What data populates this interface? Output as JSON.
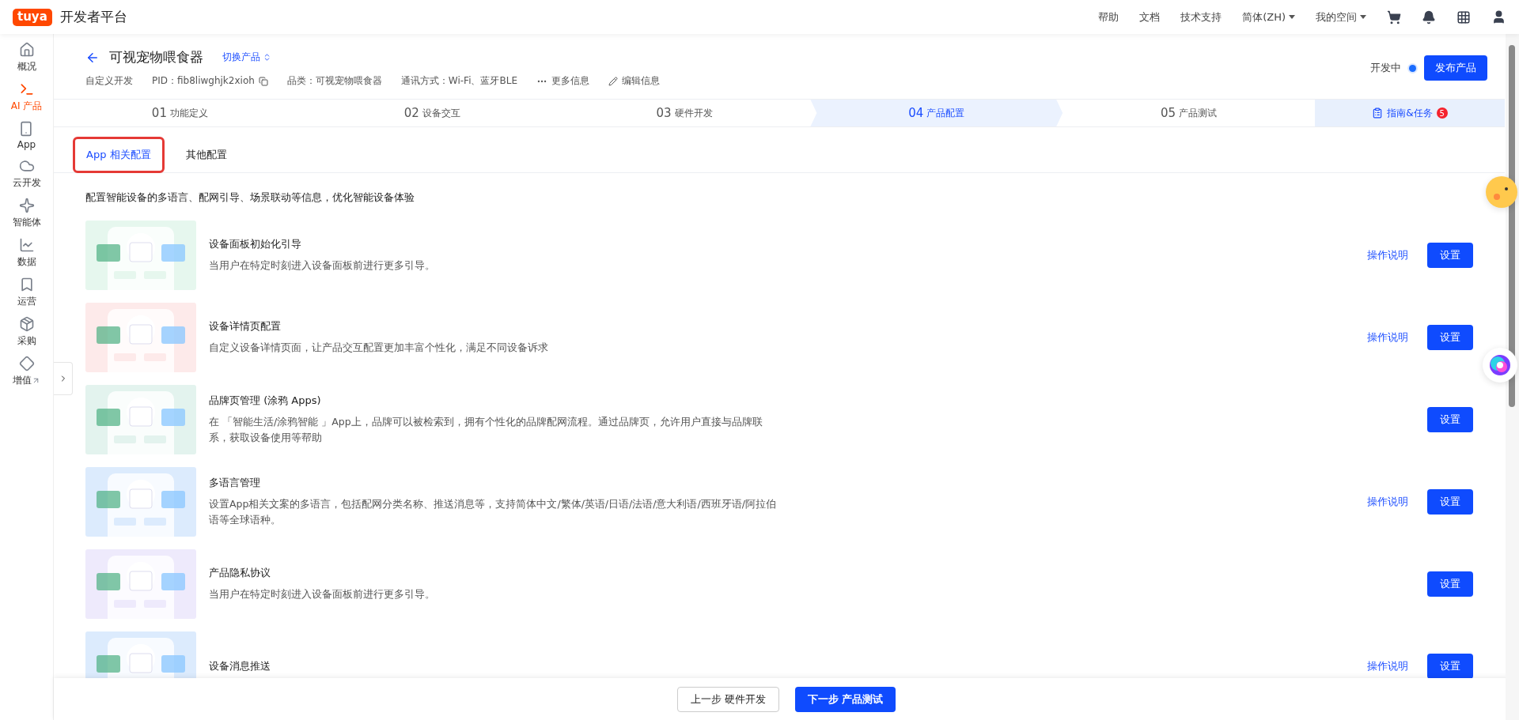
{
  "topbar": {
    "logo": "tuya",
    "title": "开发者平台",
    "links": [
      {
        "label": "帮助",
        "dropdown": false
      },
      {
        "label": "文档",
        "dropdown": false
      },
      {
        "label": "技术支持",
        "dropdown": false
      },
      {
        "label": "简体(ZH)",
        "dropdown": true
      },
      {
        "label": "我的空间",
        "dropdown": true
      }
    ]
  },
  "sidebar": {
    "items": [
      {
        "label": "概况",
        "selected": false,
        "external": false
      },
      {
        "label": "AI 产品",
        "selected": true,
        "external": false
      },
      {
        "label": "App",
        "selected": false,
        "external": false
      },
      {
        "label": "云开发",
        "selected": false,
        "external": false
      },
      {
        "label": "智能体",
        "selected": false,
        "external": false
      },
      {
        "label": "数据",
        "selected": false,
        "external": false
      },
      {
        "label": "运营",
        "selected": false,
        "external": false
      },
      {
        "label": "采购",
        "selected": false,
        "external": false
      },
      {
        "label": "增值",
        "selected": false,
        "external": true
      }
    ]
  },
  "product": {
    "name": "可视宠物喂食器",
    "switch": "切换产品",
    "meta": [
      {
        "kind": "text",
        "text": "自定义开发"
      },
      {
        "kind": "copy",
        "text": "PID：fib8liwghjk2xioh"
      },
      {
        "kind": "text",
        "text": "品类：可视宠物喂食器"
      },
      {
        "kind": "text",
        "text": "通讯方式：Wi-Fi、蓝牙BLE"
      },
      {
        "kind": "more",
        "text": "更多信息"
      },
      {
        "kind": "edit",
        "text": "编辑信息"
      }
    ],
    "status": "开发中",
    "publish": "发布产品"
  },
  "steps": [
    {
      "num": "01",
      "label": "功能定义",
      "selected": false
    },
    {
      "num": "02",
      "label": "设备交互",
      "selected": false
    },
    {
      "num": "03",
      "label": "硬件开发",
      "selected": false
    },
    {
      "num": "04",
      "label": "产品配置",
      "selected": true
    },
    {
      "num": "05",
      "label": "产品测试",
      "selected": false
    }
  ],
  "guide": {
    "label": "指南&任务",
    "badge": "5"
  },
  "tabs": [
    {
      "label": "App 相关配置",
      "selected": true,
      "highlighted": true
    },
    {
      "label": "其他配置",
      "selected": false,
      "highlighted": false
    }
  ],
  "intro": "配置智能设备的多语言、配网引导、场景联动等信息，优化智能设备体验",
  "rows": [
    {
      "title": "设备面板初始化引导",
      "description": "当用户在特定时刻进入设备面板前进行更多引导。",
      "help": "操作说明",
      "action": "设置",
      "color": "#e6f7ee"
    },
    {
      "title": "设备详情页配置",
      "description": "自定义设备详情页面，让产品交互配置更加丰富个性化，满足不同设备诉求",
      "help": "操作说明",
      "action": "设置",
      "color": "#fdeaea"
    },
    {
      "title": "品牌页管理 (涂鸦 Apps)",
      "description": "在 「智能生活/涂鸦智能 」App上，品牌可以被检索到，拥有个性化的品牌配网流程。通过品牌页，允许用户直接与品牌联系，获取设备使用等帮助",
      "action": "设置",
      "color": "#e3f3ee"
    },
    {
      "title": "多语言管理",
      "description": "设置App相关文案的多语言，包括配网分类名称、推送消息等，支持简体中文/繁体/英语/日语/法语/意大利语/西班牙语/阿拉伯语等全球语种。",
      "help": "操作说明",
      "action": "设置",
      "color": "#dcebfd"
    },
    {
      "title": "产品隐私协议",
      "description": "当用户在特定时刻进入设备面板前进行更多引导。",
      "action": "设置",
      "color": "#eeeafc"
    },
    {
      "title": "设备消息推送",
      "help": "操作说明",
      "action": "设置",
      "color": "#dcebfd"
    }
  ],
  "footer": {
    "prev": "上一步 硬件开发",
    "next": "下一步 产品测试"
  }
}
